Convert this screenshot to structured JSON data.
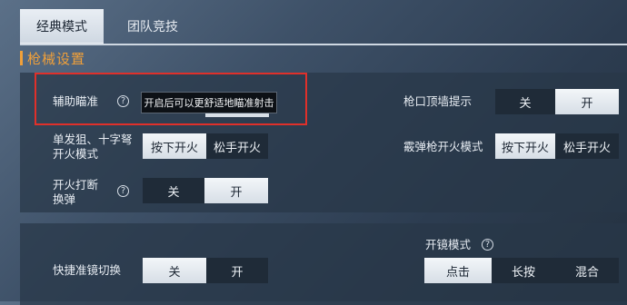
{
  "tabs": [
    {
      "label": "经典模式",
      "active": true
    },
    {
      "label": "团队竞技",
      "active": false
    }
  ],
  "section": {
    "title": "枪械设置"
  },
  "settings": {
    "aim_assist": {
      "label": "辅助瞄准",
      "help": "?",
      "tooltip": "开启后可以更舒适地瞄准射击"
    },
    "muzzle_wall": {
      "label": "枪口顶墙提示",
      "options": [
        "关",
        "开"
      ],
      "selected": "开"
    },
    "sniper_fire": {
      "line1": "单发狙、十字弩",
      "line2": "开火模式",
      "options": [
        "按下开火",
        "松手开火"
      ],
      "selected": "按下开火"
    },
    "shotgun_fire": {
      "label": "霰弹枪开火模式",
      "options": [
        "按下开火",
        "松手开火"
      ],
      "selected": "按下开火"
    },
    "fire_interrupt": {
      "line1": "开火打断",
      "line2": "换弹",
      "help": "?",
      "options": [
        "关",
        "开"
      ],
      "selected": "开"
    },
    "quick_scope": {
      "label": "快捷准镜切换",
      "options": [
        "关",
        "开"
      ],
      "selected": "关"
    },
    "scope_mode": {
      "label": "开镜模式",
      "help": "?",
      "options": [
        "点击",
        "长按",
        "混合"
      ],
      "selected": "点击"
    }
  },
  "colors": {
    "accent": "#f0a03a",
    "highlight_box": "#e0302a"
  }
}
